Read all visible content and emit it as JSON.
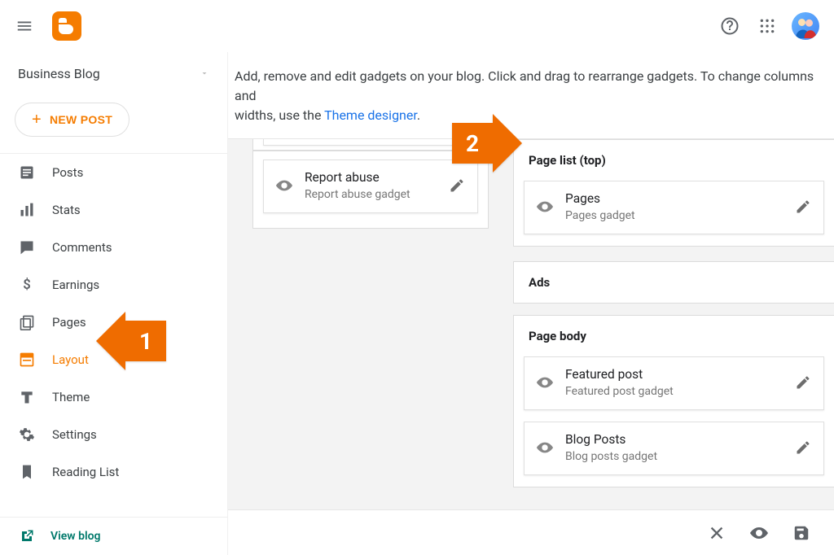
{
  "header": {
    "help_icon": "help-circle",
    "apps_icon": "apps-grid",
    "avatar_icon": "avatar"
  },
  "sidebar": {
    "blog_name": "Business Blog",
    "new_post_label": "NEW POST",
    "items": [
      {
        "icon": "posts-icon",
        "label": "Posts"
      },
      {
        "icon": "stats-icon",
        "label": "Stats"
      },
      {
        "icon": "comments-icon",
        "label": "Comments"
      },
      {
        "icon": "earnings-icon",
        "label": "Earnings"
      },
      {
        "icon": "pages-icon",
        "label": "Pages"
      },
      {
        "icon": "layout-icon",
        "label": "Layout"
      },
      {
        "icon": "theme-icon",
        "label": "Theme"
      },
      {
        "icon": "settings-icon",
        "label": "Settings"
      },
      {
        "icon": "reading-icon",
        "label": "Reading List"
      }
    ],
    "active_index": 5,
    "view_blog_label": "View blog"
  },
  "main": {
    "intro_text_1": "Add, remove and edit gadgets on your blog. Click and drag to rearrange gadgets. To change columns and",
    "intro_text_2a": "widths, use the ",
    "intro_link": "Theme designer",
    "intro_text_2b": ".",
    "left_gadgets": [
      {
        "title": "Report abuse",
        "subtitle": "Report abuse gadget"
      }
    ],
    "right_sections": [
      {
        "header": "Page list (top)",
        "gadgets": [
          {
            "title": "Pages",
            "subtitle": "Pages gadget"
          }
        ]
      },
      {
        "header": "Ads",
        "gadgets": []
      },
      {
        "header": "Page body",
        "gadgets": [
          {
            "title": "Featured post",
            "subtitle": "Featured post gadget"
          },
          {
            "title": "Blog Posts",
            "subtitle": "Blog posts gadget"
          }
        ]
      }
    ]
  },
  "annotations": {
    "arrow1": "1",
    "arrow2": "2"
  },
  "bottombar": {
    "close_icon": "close",
    "preview_icon": "eye",
    "save_icon": "save"
  }
}
